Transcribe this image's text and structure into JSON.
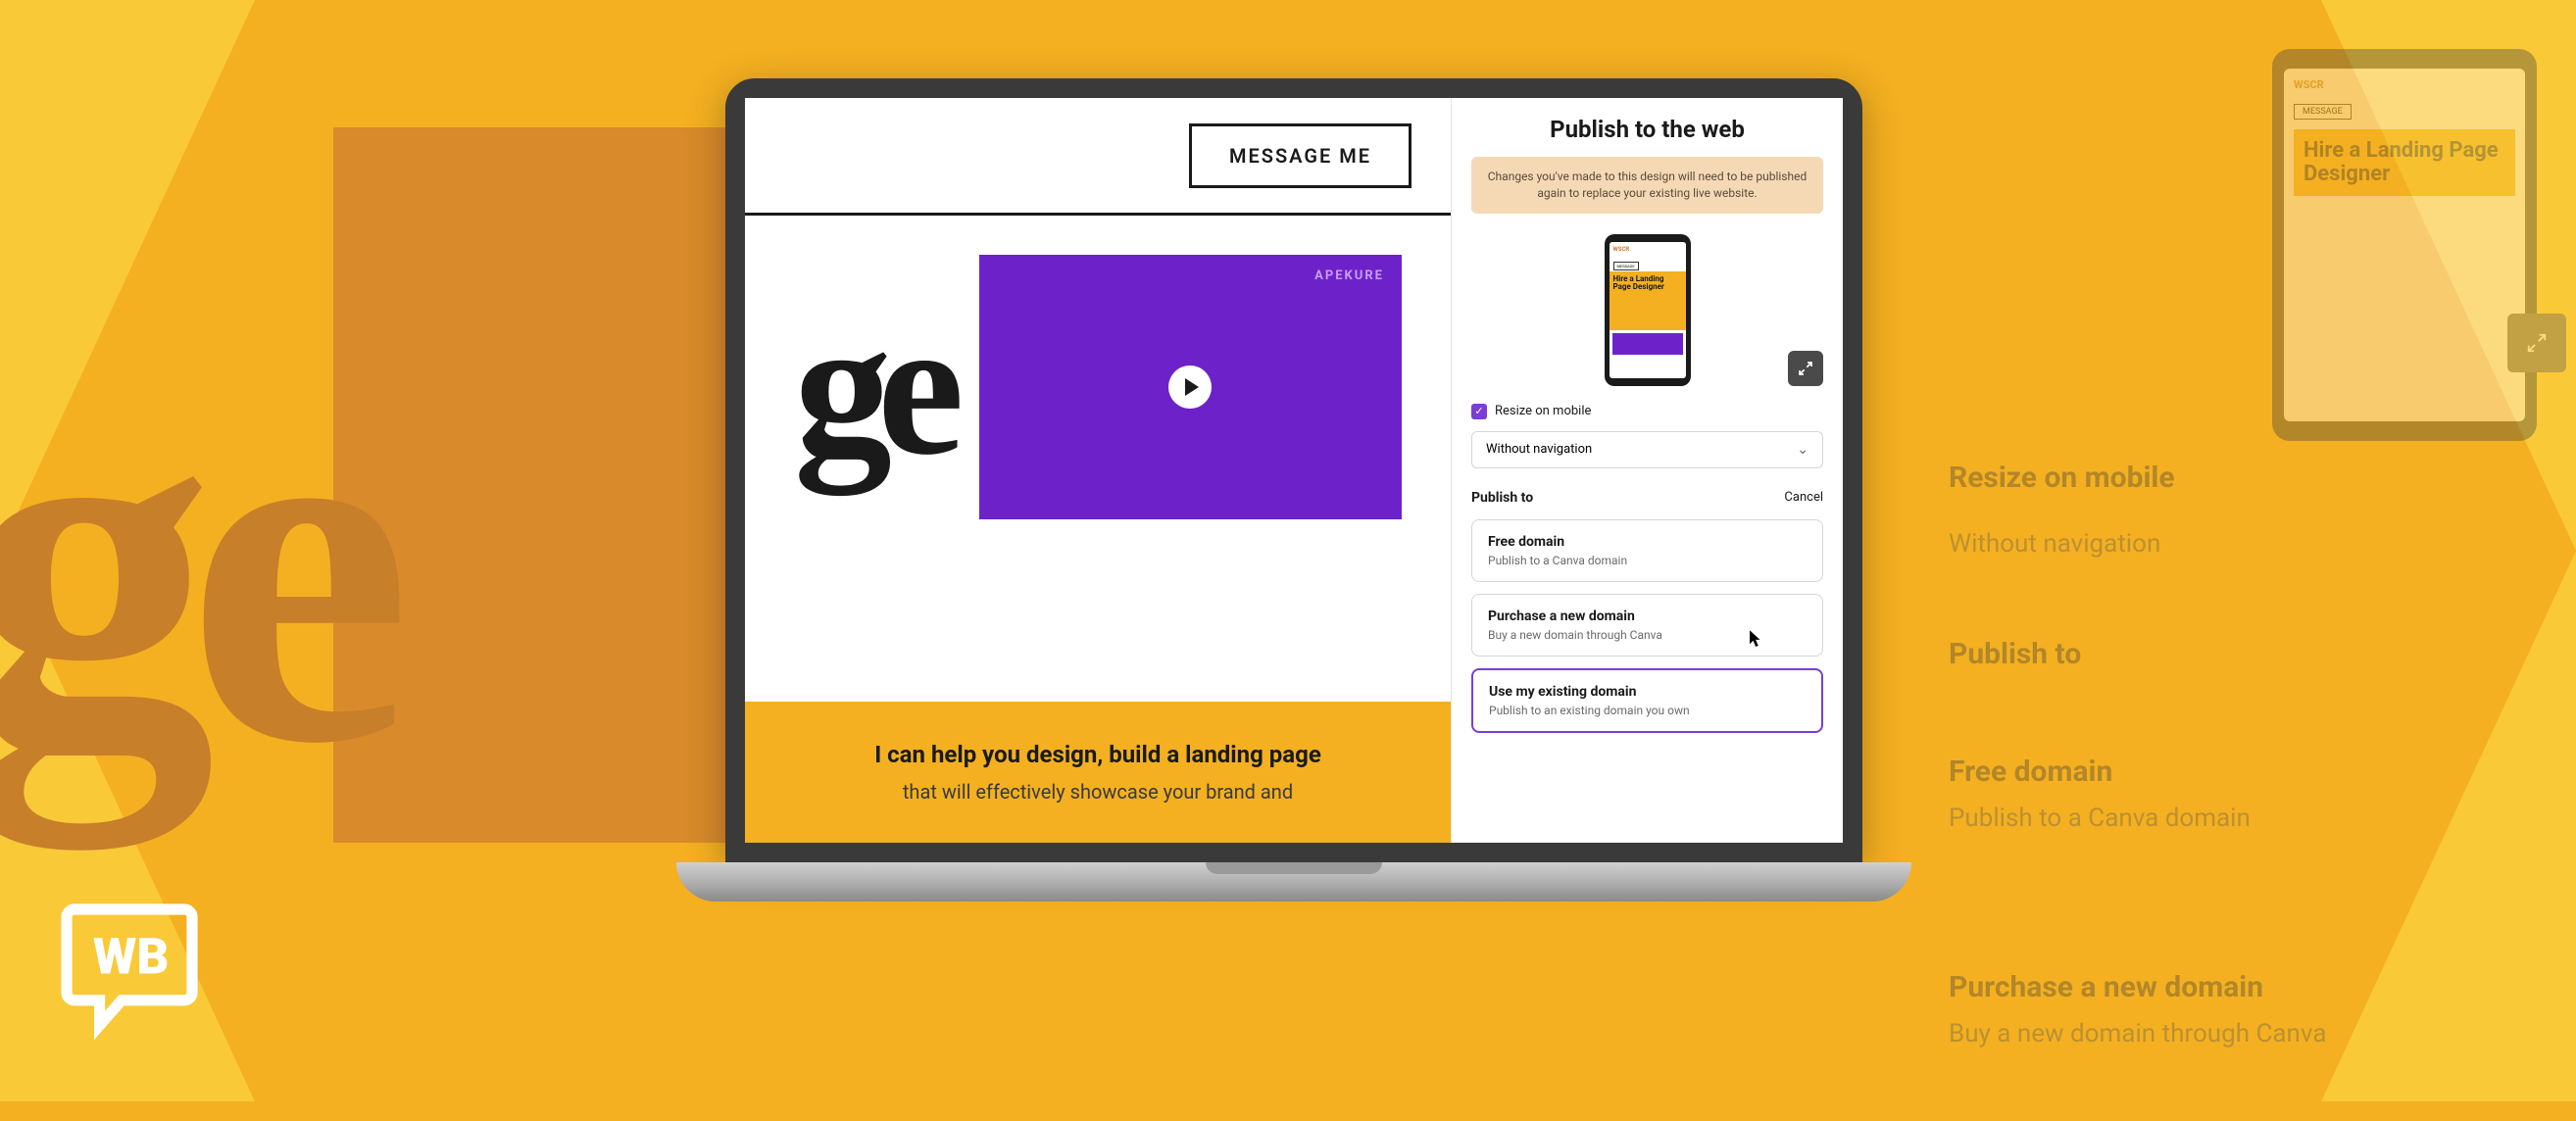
{
  "background": {
    "big_text": "ge",
    "logo_text": "WB",
    "zoom": {
      "resize_label": "Resize on mobile",
      "nav_label": "Without navigation",
      "publish_to": "Publish to",
      "free_title": "Free domain",
      "free_sub": "Publish to a Canva domain",
      "purchase_title": "Purchase a new domain",
      "purchase_sub": "Buy a new domain through Canva",
      "phone_hero": "Hire a Landing Page Designer"
    }
  },
  "canvas": {
    "message_btn": "MESSAGE ME",
    "big_ge": "ge",
    "video_brand": "APEKURE",
    "footer_title": "I can help you design, build a landing page",
    "footer_sub": "that will effectively showcase your brand and"
  },
  "panel": {
    "title": "Publish to the web",
    "warning": "Changes you've made to this design will need to be published again to replace your existing live website.",
    "resize_label": "Resize on mobile",
    "nav_select": "Without navigation",
    "publish_to_label": "Publish to",
    "cancel": "Cancel",
    "phone_preview": {
      "brand": "WSCR",
      "btn": "MESSAGE",
      "hero": "Hire a Landing Page Designer"
    },
    "options": [
      {
        "title": "Free domain",
        "sub": "Publish to a Canva domain"
      },
      {
        "title": "Purchase a new domain",
        "sub": "Buy a new domain through Canva"
      },
      {
        "title": "Use my existing domain",
        "sub": "Publish to an existing domain you own"
      }
    ]
  }
}
